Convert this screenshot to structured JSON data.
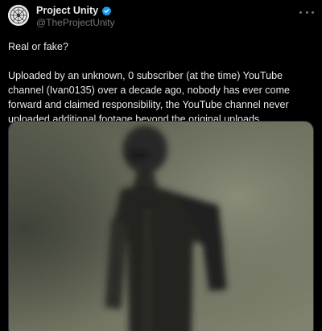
{
  "author": {
    "display_name": "Project Unity",
    "handle": "@TheProjectUnity",
    "verified": true,
    "verified_color": "#1d9bf0",
    "avatar_icon": "cult-emblem-icon"
  },
  "post": {
    "text_line_1": "Real or fake?",
    "text_paragraph_2": "Uploaded by an unknown, 0 subscriber (at the time) YouTube channel (Ivan0135) over a decade ago, nobody has ever come forward and claimed responsibility, the YouTube channel never uploaded additional footage beyond the original uploads."
  },
  "actions": {
    "more_icon": "more-horizontal-icon"
  },
  "colors": {
    "background": "#000000",
    "text": "#e7e9ea",
    "muted": "#71767b"
  }
}
